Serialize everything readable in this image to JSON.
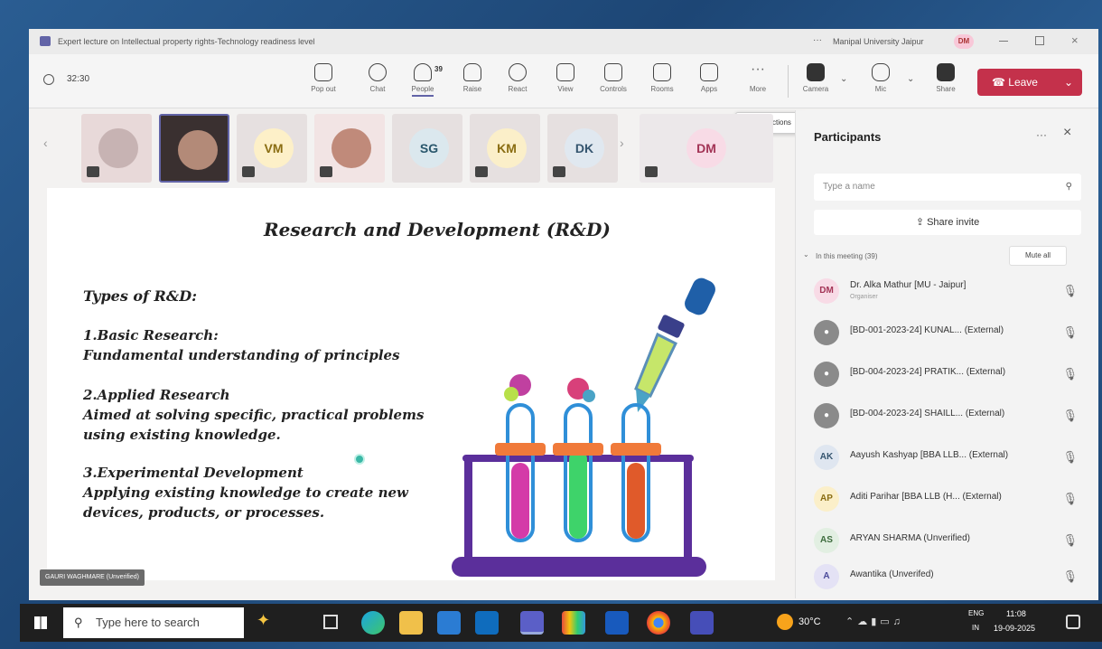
{
  "window": {
    "title": "Expert lecture on Intellectual property rights-Technology readiness level",
    "org": "Manipal University Jaipur",
    "user_initials": "DM"
  },
  "toolbar": {
    "timer": "32:30",
    "people_count": "39",
    "buttons": [
      "Pop out",
      "Chat",
      "People",
      "Raise",
      "React",
      "View",
      "Controls",
      "Rooms",
      "Apps",
      "More"
    ],
    "devices": [
      "Camera",
      "Mic",
      "Share"
    ],
    "leave_label": "Leave",
    "tooltip": "More actions"
  },
  "strip": {
    "tiles": [
      {
        "initials": "",
        "color": "#e8d9d9"
      },
      {
        "initials": "",
        "color": "#3a3030"
      },
      {
        "initials": "VM",
        "color": "#fdf0c8"
      },
      {
        "initials": "",
        "color": "#f2e4e4"
      },
      {
        "initials": "SG",
        "color": "#dbe8ee"
      },
      {
        "initials": "KM",
        "color": "#fbefc9"
      },
      {
        "initials": "DK",
        "color": "#e0e8f0"
      },
      {
        "initials": "DM",
        "color": "#f8dbe6"
      }
    ]
  },
  "slide": {
    "title": "Research and Development (R&D)",
    "types_heading": "Types of R&D:",
    "item1_title": "1.Basic Research:",
    "item1_desc": "Fundamental understanding of principles",
    "item2_title": "2.Applied Research",
    "item2_desc_1": "Aimed at solving specific, practical problems",
    "item2_desc_2": "using existing knowledge.",
    "item3_title": "3.Experimental Development",
    "item3_desc_1": "Applying existing knowledge to create new",
    "item3_desc_2": "devices, products, or processes.",
    "presenter": "GAURI WAGHMARE (Unverified)"
  },
  "participants": {
    "title": "Participants",
    "search_placeholder": "Type a name",
    "share_invite": "Share invite",
    "section_label": "In this meeting (39)",
    "mute_all": "Mute all",
    "list": [
      {
        "initials": "DM",
        "name": "Dr. Alka Mathur [MU - Jaipur]",
        "role": "Organiser",
        "color": "#f8dbe6"
      },
      {
        "initials": "",
        "name": "[BD-001-2023-24] KUNAL... (External)",
        "role": "",
        "color": "#8a8a8a"
      },
      {
        "initials": "",
        "name": "[BD-004-2023-24] PRATIK... (External)",
        "role": "",
        "color": "#8a8a8a"
      },
      {
        "initials": "",
        "name": "[BD-004-2023-24] SHAILL... (External)",
        "role": "",
        "color": "#8a8a8a"
      },
      {
        "initials": "AK",
        "name": "Aayush Kashyap [BBA LLB... (External)",
        "role": "",
        "color": "#dfe6f0"
      },
      {
        "initials": "AP",
        "name": "Aditi Parihar [BBA LLB (H... (External)",
        "role": "",
        "color": "#fbefc9"
      },
      {
        "initials": "AS",
        "name": "ARYAN SHARMA (Unverified)",
        "role": "",
        "color": "#e2efe2"
      },
      {
        "initials": "A",
        "name": "Awantika (Unverifed)",
        "role": "",
        "color": "#e4e2f5"
      }
    ]
  },
  "taskbar": {
    "search_placeholder": "Type here to search",
    "temperature": "30°C",
    "lang_1": "ENG",
    "lang_2": "IN",
    "time": "11:08",
    "date": "19-09-2025"
  }
}
